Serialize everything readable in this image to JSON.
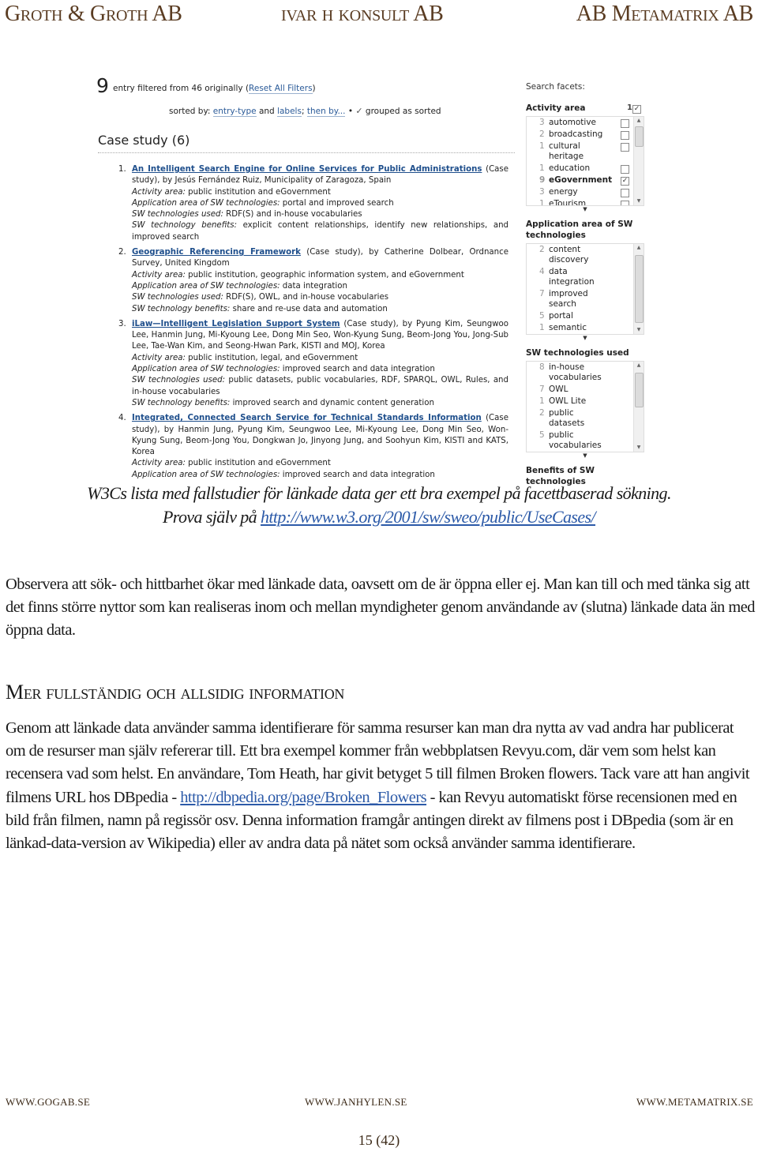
{
  "header": {
    "left": "Groth & Groth AB",
    "center": "ivar h konsult AB",
    "right": "AB Metamatrix AB"
  },
  "screenshot": {
    "count": "9",
    "count_text": "entry filtered from 46 originally (",
    "reset_link": "Reset All Filters",
    "count_close": ")",
    "sorted_by_label": "sorted by:",
    "sort_entry_type": "entry-type",
    "sort_and": "and",
    "sort_labels": "labels",
    "sort_semicolon": ";",
    "sort_then_by": "then by...",
    "sort_bullet": "•",
    "grouped_check": "✓",
    "grouped_label": "grouped as sorted",
    "group_title": "Case study (6)",
    "results": [
      {
        "num": "1.",
        "title": "An Intelligent Search Engine for Online Services for Public Administrations",
        "byline": " (Case study), by Jesús Fernández Ruiz, Municipality of Zaragoza, Spain",
        "activity_label": "Activity area:",
        "activity": " public institution and eGovernment",
        "application_label": "Application area of SW technologies:",
        "application": " portal and improved search",
        "used_label": "SW technologies used:",
        "used": " RDF(S) and in-house vocabularies",
        "benefits_label": "SW technology benefits:",
        "benefits": " explicit content relationships, identify new relationships, and improved search"
      },
      {
        "num": "2.",
        "title": "Geographic Referencing Framework",
        "byline": " (Case study), by Catherine Dolbear, Ordnance Survey, United Kingdom",
        "activity_label": "Activity area:",
        "activity": " public institution, geographic information system, and eGovernment",
        "application_label": "Application area of SW technologies:",
        "application": " data integration",
        "used_label": "SW technologies used:",
        "used": " RDF(S), OWL, and in-house vocabularies",
        "benefits_label": "SW technology benefits:",
        "benefits": " share and re-use data and automation"
      },
      {
        "num": "3.",
        "title": "iLaw—Intelligent Legislation Support System",
        "byline": " (Case study), by Pyung Kim, Seungwoo Lee, Hanmin Jung, Mi-Kyoung Lee, Dong Min Seo, Won-Kyung Sung, Beom-Jong You, Jong-Sub Lee, Tae-Wan Kim, and Seong-Hwan Park, KISTI and MOJ, Korea",
        "activity_label": "Activity area:",
        "activity": " public institution, legal, and eGovernment",
        "application_label": "Application area of SW technologies:",
        "application": " improved search and data integration",
        "used_label": "SW technologies used:",
        "used": " public datasets, public vocabularies, RDF, SPARQL, OWL, Rules, and in-house vocabularies",
        "benefits_label": "SW technology benefits:",
        "benefits": " improved search and dynamic content generation"
      },
      {
        "num": "4.",
        "title": "Integrated, Connected Search Service for Technical Standards Information",
        "byline": " (Case study), by Hanmin Jung, Pyung Kim, Seungwoo Lee, Mi-Kyoung Lee, Dong Min Seo, Won-Kyung Sung, Beom-Jong You, Dongkwan Jo, Jinyong Jung, and Soohyun Kim, KISTI and KATS, Korea",
        "activity_label": "Activity area:",
        "activity": " public institution and eGovernment",
        "application_label": "Application area of SW technologies:",
        "application": " improved search and data integration"
      }
    ],
    "facets": {
      "heading": "Search facets:",
      "activity_area": {
        "title": "Activity area",
        "selected_count": "1",
        "items": [
          {
            "count": "3",
            "label": "automotive",
            "checked": false
          },
          {
            "count": "2",
            "label": "broadcasting",
            "checked": false
          },
          {
            "count": "1",
            "label": "cultural heritage",
            "checked": false
          },
          {
            "count": "1",
            "label": "education",
            "checked": false
          },
          {
            "count": "9",
            "label": "eGovernment",
            "checked": true
          },
          {
            "count": "3",
            "label": "energy",
            "checked": false
          },
          {
            "count": "1",
            "label": "eTourism",
            "checked": false
          }
        ]
      },
      "application_area": {
        "title": "Application area of SW technologies",
        "items": [
          {
            "count": "2",
            "label": "content discovery"
          },
          {
            "count": "4",
            "label": "data integration"
          },
          {
            "count": "7",
            "label": "improved search"
          },
          {
            "count": "5",
            "label": "portal"
          },
          {
            "count": "1",
            "label": "semantic annotation"
          }
        ]
      },
      "technologies_used": {
        "title": "SW technologies used",
        "items": [
          {
            "count": "8",
            "label": "in-house vocabularies"
          },
          {
            "count": "7",
            "label": "OWL"
          },
          {
            "count": "1",
            "label": "OWL Lite"
          },
          {
            "count": "2",
            "label": "public datasets"
          },
          {
            "count": "5",
            "label": "public vocabularies"
          }
        ]
      },
      "benefits": {
        "title": "Benefits of SW technologies"
      }
    }
  },
  "caption": {
    "line1": "W3Cs lista med fallstudier för länkade data ger ett bra exempel på facettbaserad sökning.",
    "line2_prefix": "Prova själv på ",
    "link": "http://www.w3.org/2001/sw/sweo/public/UseCases/"
  },
  "paragraph1": "Observera att sök- och hittbarhet ökar med länkade data, oavsett om de är öppna eller ej. Man kan till och med tänka sig att det finns större nyttor som kan realiseras inom och mellan myndigheter genom användande av (slutna) länkade data än med öppna data.",
  "section_heading": "Mer fullständig och allsidig information",
  "paragraph2": {
    "before_link": "Genom att länkade data använder samma identifierare för samma resurser kan man dra nytta av vad andra har publicerat om de resurser man själv refererar till. Ett bra exempel kommer från webbplatsen Revyu.com, där vem som helst kan recensera vad som helst. En användare, Tom Heath, har givit betyget 5 till filmen Broken flowers. Tack vare att han angivit filmens URL hos DBpedia - ",
    "link": "http://dbpedia.org/page/Broken_Flowers",
    "after_link": " - kan Revyu automatiskt förse recensionen med en bild från filmen, namn på regissör osv. Denna information framgår antingen direkt av filmens post i DBpedia (som är en länkad-data-version av Wikipedia) eller av andra data på nätet som också använder samma identifierare."
  },
  "footer": {
    "left": "WWW.GOGAB.SE",
    "center": "WWW.JANHYLEN.SE",
    "right": "WWW.METAMATRIX.SE",
    "page": "15 (42)"
  },
  "colors": {
    "header_brown": "#5a3c22",
    "link_blue": "#2c5aa8",
    "ui_link_blue": "#1f4f8c"
  }
}
